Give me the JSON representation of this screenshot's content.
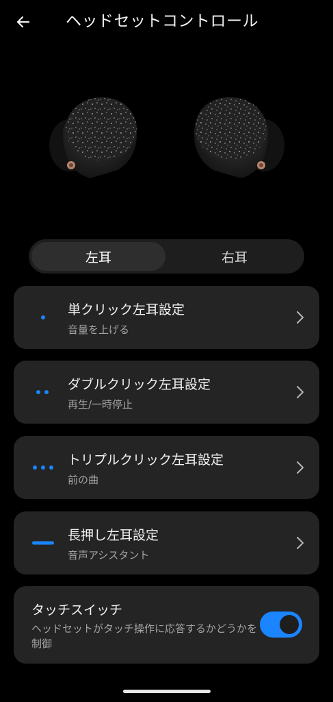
{
  "header": {
    "title": "ヘッドセットコントロール",
    "back_icon": "arrow-left-icon"
  },
  "tabs": {
    "left_label": "左耳",
    "right_label": "右耳",
    "selected": "左耳"
  },
  "gestures": [
    {
      "title": "単クリック左耳設定",
      "action": "音量を上げる",
      "indicator": "one-dot"
    },
    {
      "title": "ダブルクリック左耳設定",
      "action": "再生/一時停止",
      "indicator": "two-dots"
    },
    {
      "title": "トリプルクリック左耳設定",
      "action": "前の曲",
      "indicator": "three-dots"
    },
    {
      "title": "長押し左耳設定",
      "action": "音声アシスタント",
      "indicator": "long-bar"
    }
  ],
  "touch_switch": {
    "title": "タッチスイッチ",
    "description": "ヘッドセットがタッチ操作に応答するかどうかを制御",
    "enabled": true
  },
  "colors": {
    "background": "#000000",
    "card": "#242424",
    "accent": "#1a85ff"
  }
}
